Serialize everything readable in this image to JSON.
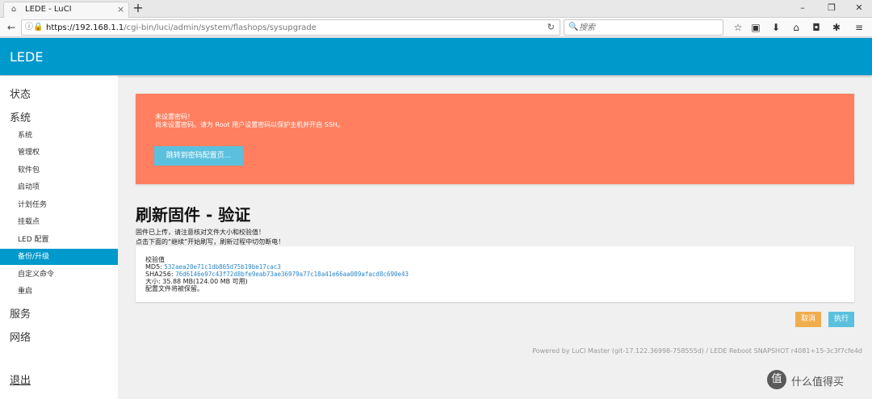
{
  "browser": {
    "tab_title": "LEDE - LuCI",
    "tab_close": "×",
    "new_tab": "+",
    "url_host": "https://192.168.1.1",
    "url_path": "/cgi-bin/luci/admin/system/flashops/sysupgrade",
    "search_placeholder": "搜索",
    "icons": [
      "star-icon",
      "reading-list-icon",
      "download-icon",
      "home-icon",
      "pocket-icon",
      "extension-icon",
      "menu-icon"
    ]
  },
  "header": {
    "brand": "LEDE"
  },
  "sidebar": {
    "main_items": [
      "状态",
      "系统",
      "服务",
      "网络"
    ],
    "sub_items": [
      "系统",
      "管理权",
      "软件包",
      "启动项",
      "计划任务",
      "挂载点",
      "LED 配置",
      "备份/升级",
      "自定义命令",
      "重启"
    ],
    "active_index": 7,
    "logout": "退出"
  },
  "alert": {
    "line1": "未设置密码！",
    "line2": "尚未设置密码。请为 Root 用户设置密码以保护主机并开启 SSH。",
    "button": "跳转到密码配置页..."
  },
  "main": {
    "title": "刷新固件 - 验证",
    "desc1": "固件已上传，请注意核对文件大小和校验值！",
    "desc2": "点击下面的“继续”开始刷写，刷新过程中切勿断电！",
    "checksum_label": "校验值",
    "md5_label": "MD5:",
    "md5": "532aea20e71c1db865d75b19be17cac3",
    "sha_label": "SHA256:",
    "sha256": "76d6146e97c43f72d8bfe9eab73ae36979a77c18a41e66aa089afacd8c690e43",
    "size": "大小: 35.88 MB(124.00 MB 可用)",
    "keep": "配置文件将被保留。",
    "cancel": "取消",
    "execute": "执行"
  },
  "footer": {
    "text": "Powered by LuCI Master (git-17.122.36998-758555d) / LEDE Reboot SNAPSHOT r4081+15-3c3f7cfe4d"
  },
  "watermark": {
    "glyph": "值",
    "text": "什么值得买"
  }
}
